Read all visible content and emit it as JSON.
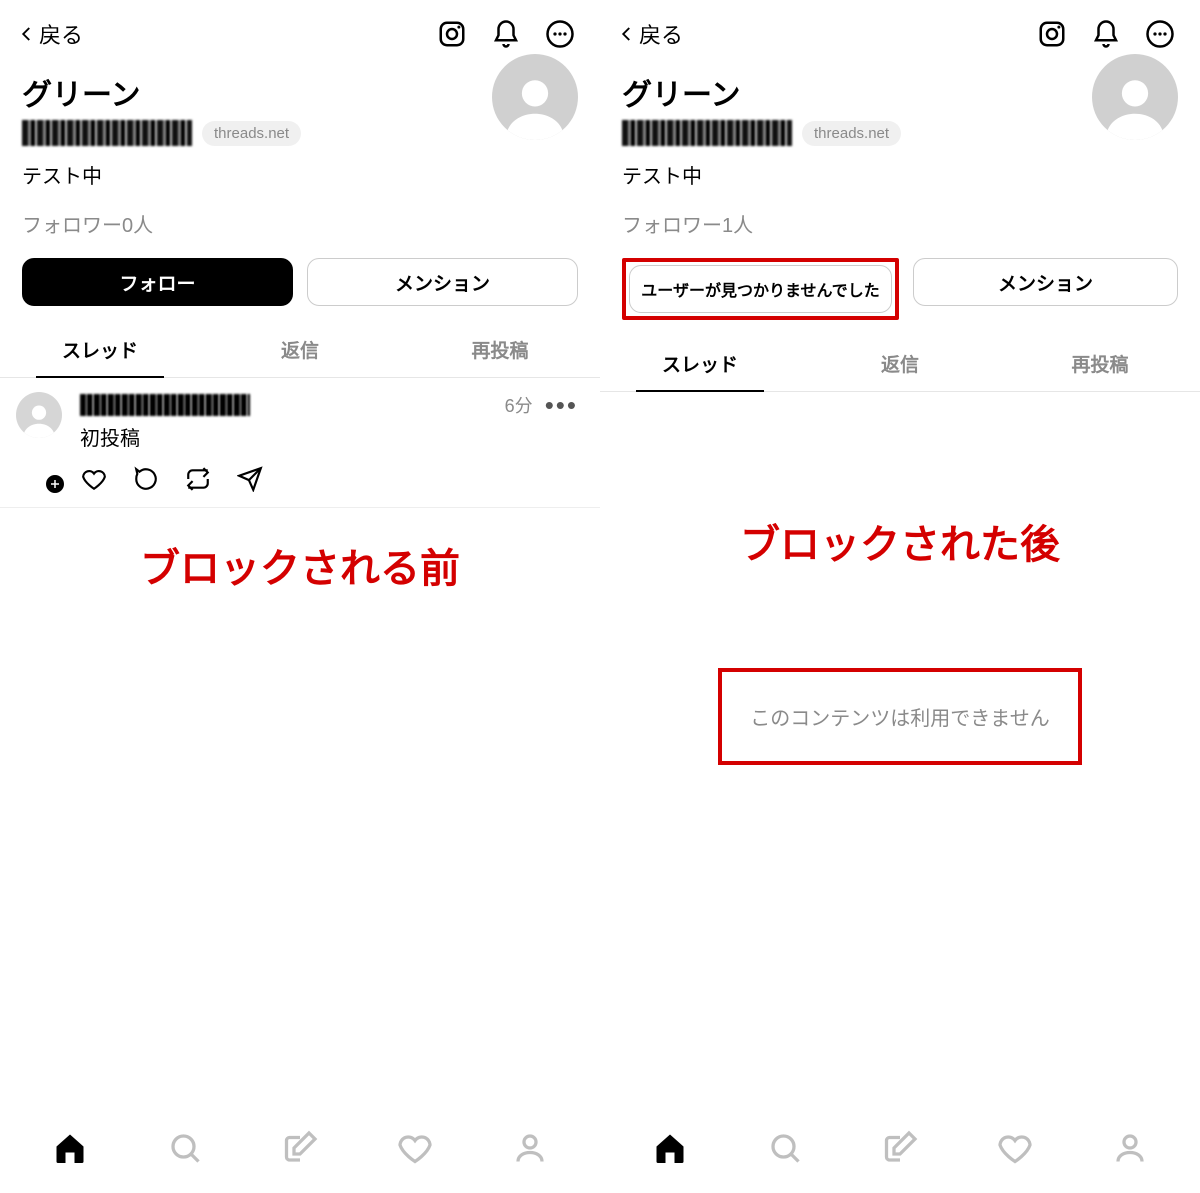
{
  "left": {
    "back_label": "戻る",
    "display_name": "グリーン",
    "threads_badge": "threads.net",
    "bio": "テスト中",
    "followers_label": "フォロワー0人",
    "follow_button": "フォロー",
    "mention_button": "メンション",
    "tabs": {
      "threads": "スレッド",
      "replies": "返信",
      "reposts": "再投稿"
    },
    "post": {
      "time": "6分",
      "text": "初投稿"
    },
    "annotation": "ブロックされる前"
  },
  "right": {
    "back_label": "戻る",
    "display_name": "グリーン",
    "threads_badge": "threads.net",
    "bio": "テスト中",
    "followers_label": "フォロワー1人",
    "not_found_button": "ユーザーが見つかりませんでした",
    "mention_button": "メンション",
    "tabs": {
      "threads": "スレッド",
      "replies": "返信",
      "reposts": "再投稿"
    },
    "annotation": "ブロックされた後",
    "unavailable": "このコンテンツは利用できません"
  }
}
